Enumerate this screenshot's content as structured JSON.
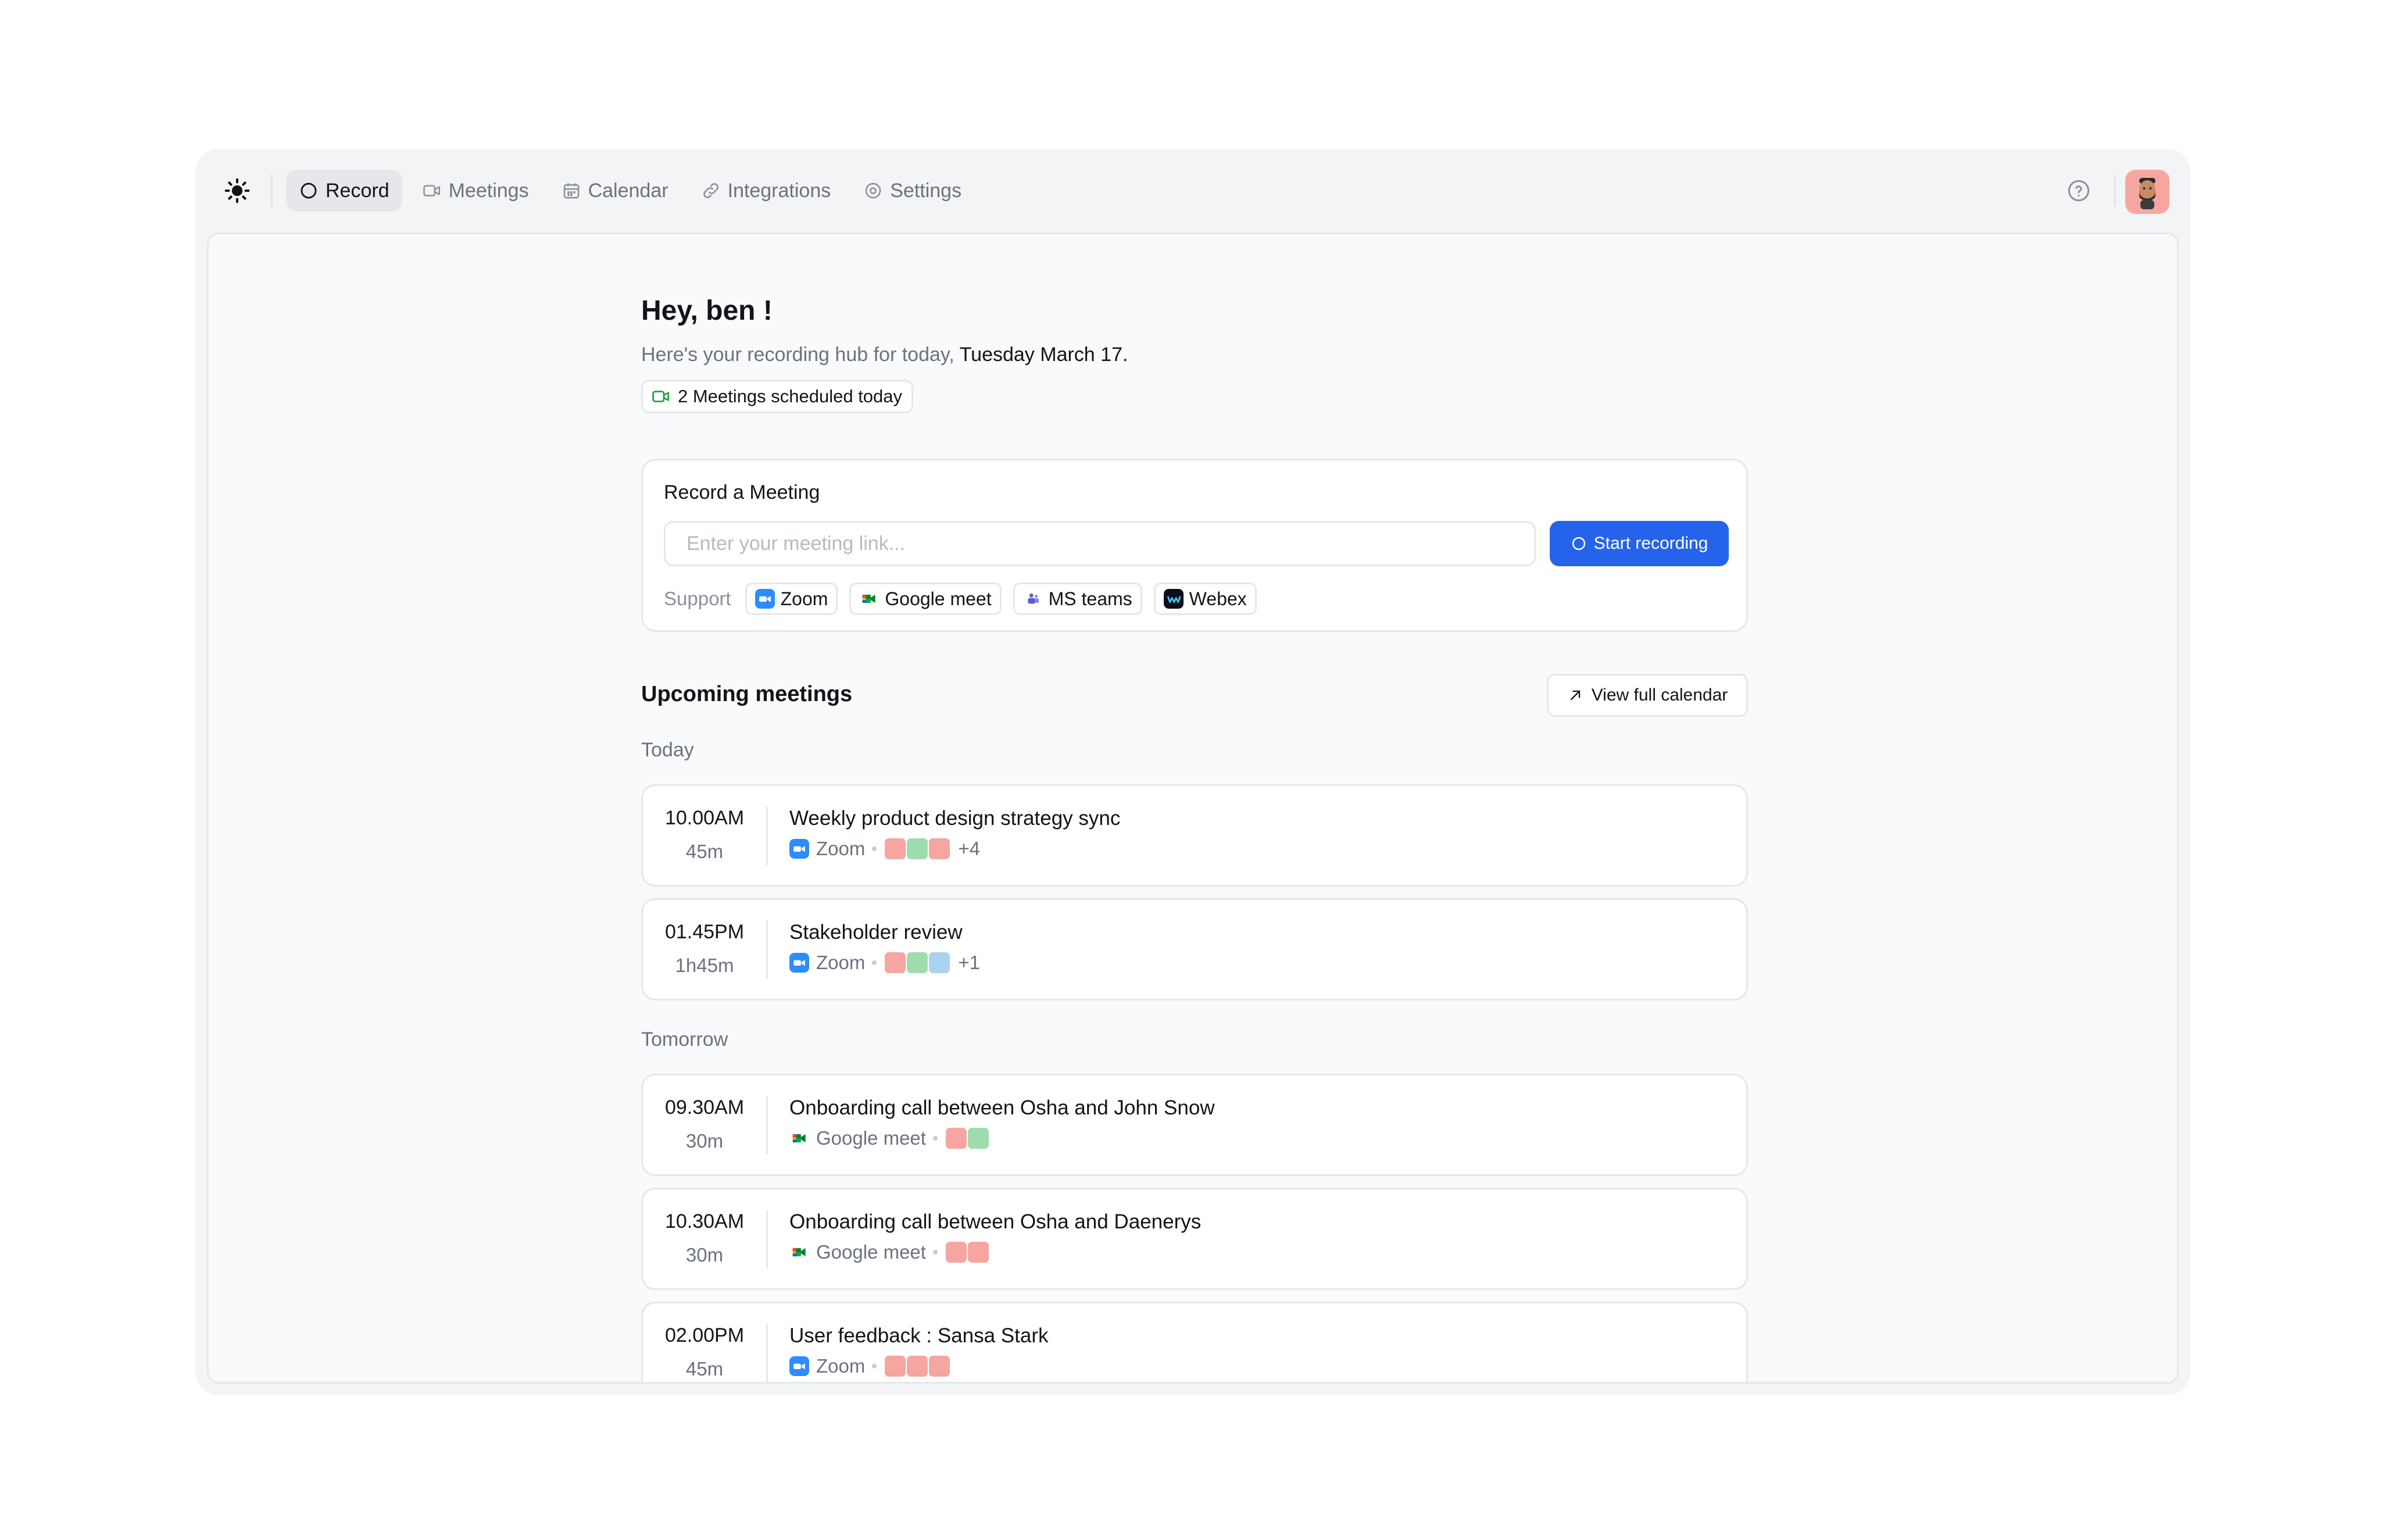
{
  "nav": {
    "items": [
      {
        "label": "Record",
        "icon": "circle-icon",
        "active": true
      },
      {
        "label": "Meetings",
        "icon": "video-icon",
        "active": false
      },
      {
        "label": "Calendar",
        "icon": "calendar-icon",
        "active": false
      },
      {
        "label": "Integrations",
        "icon": "link-icon",
        "active": false
      },
      {
        "label": "Settings",
        "icon": "gear-icon",
        "active": false
      }
    ]
  },
  "header": {
    "greeting": "Hey, ben !",
    "subline_prefix": "Here's your recording hub for today,",
    "date": "Tuesday March 17.",
    "meetings_count_label": "2 Meetings scheduled today"
  },
  "record": {
    "title": "Record a Meeting",
    "input_placeholder": "Enter your meeting link...",
    "input_value": "",
    "start_label": "Start recording",
    "support_label": "Support",
    "platforms": [
      "Zoom",
      "Google meet",
      "MS teams",
      "Webex"
    ]
  },
  "upcoming": {
    "title": "Upcoming meetings",
    "view_calendar_label": "View full calendar",
    "groups": [
      {
        "label": "Today",
        "meetings": [
          {
            "time": "10.00AM",
            "duration": "45m",
            "title": "Weekly product design strategy sync",
            "platform": "Zoom",
            "extra": "+4"
          },
          {
            "time": "01.45PM",
            "duration": "1h45m",
            "title": "Stakeholder review",
            "platform": "Zoom",
            "extra": "+1"
          }
        ]
      },
      {
        "label": "Tomorrow",
        "meetings": [
          {
            "time": "09.30AM",
            "duration": "30m",
            "title": "Onboarding call between Osha and John Snow",
            "platform": "Google meet",
            "extra": ""
          },
          {
            "time": "10.30AM",
            "duration": "30m",
            "title": "Onboarding call between Osha and Daenerys",
            "platform": "Google meet",
            "extra": ""
          },
          {
            "time": "02.00PM",
            "duration": "45m",
            "title": "User feedback : Sansa Stark",
            "platform": "Zoom",
            "extra": ""
          }
        ]
      }
    ]
  },
  "colors": {
    "accent": "#2563eb",
    "zoom": "#2d8cff",
    "teams": "#5b5fc7",
    "webex": "#0b0f19",
    "green": "#22a447",
    "avatar_pink": "#f6a6a0",
    "avatar_green": "#9fdcae",
    "avatar_blue": "#a9d3f0"
  }
}
